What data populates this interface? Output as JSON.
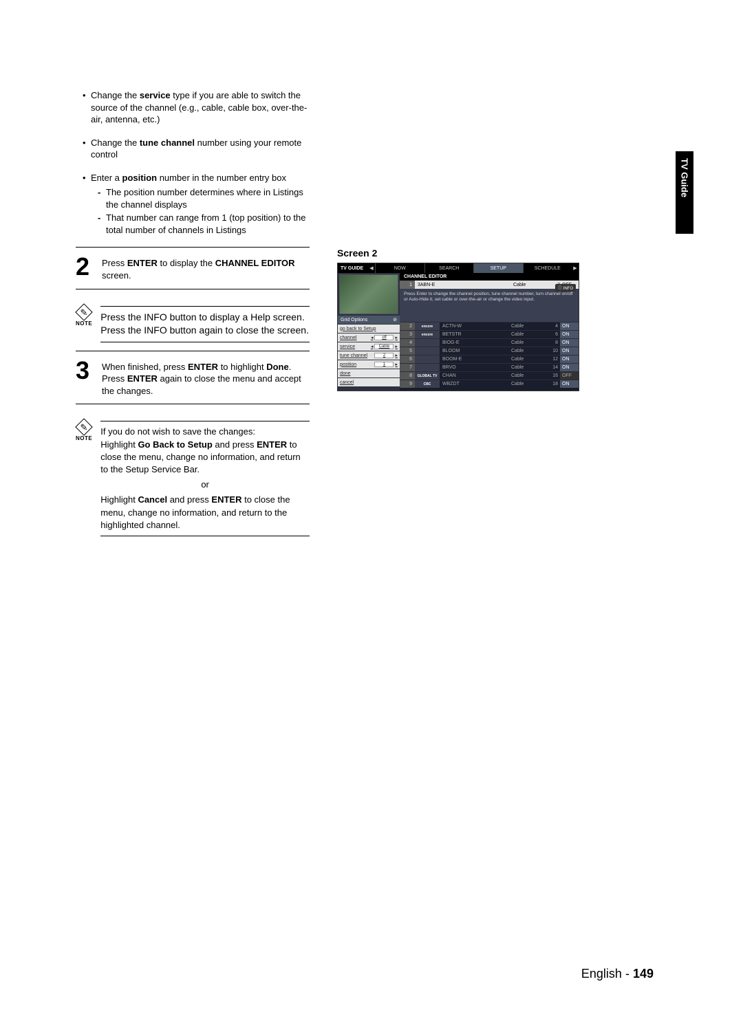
{
  "sideTab": "TV Guide",
  "bullets": [
    {
      "pre": "Change the ",
      "bold": "service",
      "post": " type if you are able to switch the source of the channel (e.g., cable, cable box, over-the-air, antenna, etc.)"
    },
    {
      "pre": "Change the ",
      "bold": "tune channel",
      "post": " number using your remote control"
    },
    {
      "pre": "Enter a ",
      "bold": "position",
      "post": " number in the number entry box",
      "sub": [
        "The position number determines where in Listings the channel displays",
        "That number can range from 1 (top position) to the total number of channels in Listings"
      ]
    }
  ],
  "step2": {
    "num": "2",
    "pre": "Press ",
    "b1": "ENTER",
    "mid": " to display the ",
    "b2": "CHANNEL EDITOR",
    "post": " screen."
  },
  "note1": {
    "label": "NOTE",
    "text": "Press the INFO button to display a Help screen. Press the INFO button again to close the screen."
  },
  "step3": {
    "num": "3",
    "line1_pre": "When finished, press ",
    "line1_b1": "ENTER",
    "line1_mid": " to highlight ",
    "line1_b2": "Done",
    "line1_post": ".",
    "line2_pre": "Press ",
    "line2_b1": "ENTER",
    "line2_post": " again to close the menu and accept the changes."
  },
  "note2": {
    "label": "NOTE",
    "intro": "If you do not wish to save the changes:",
    "p1_pre": "Highlight ",
    "p1_b1": "Go Back to Setup",
    "p1_mid": " and press ",
    "p1_b2": "ENTER",
    "p1_post": " to close the menu, change no information, and return to the Setup Service Bar.",
    "or": "or",
    "p2_pre": "Highlight ",
    "p2_b1": "Cancel",
    "p2_mid": " and press ",
    "p2_b2": "ENTER",
    "p2_post": " to close the menu, change no information, and return to the highlighted channel."
  },
  "screenLabel": "Screen 2",
  "tv": {
    "logo": "TV GUIDE",
    "tabs": [
      "NOW",
      "SEARCH",
      "SETUP",
      "SCHEDULE"
    ],
    "activeTab": 2,
    "editorHeader": "CHANNEL EDITOR",
    "infoBtn": "ⓘ INFO",
    "selected": {
      "num": "1",
      "name": "3ABN-E",
      "svc": "Cable",
      "n2": "2",
      "state": "OFF"
    },
    "hint": "Press Enter to change the channel position, tune channel number, turn channel on/off or Auto-Hide it, set cable or over-the-air or change the video input.",
    "gridHeader": "Grid Options",
    "gridRows": [
      {
        "label": "go back to Setup",
        "val": ""
      },
      {
        "label": "channel",
        "val": "off"
      },
      {
        "label": "service",
        "val": "Cable"
      },
      {
        "label": "tune channel",
        "val": "2"
      },
      {
        "label": "position",
        "val": "1"
      },
      {
        "label": "done",
        "val": ""
      },
      {
        "label": "cancel",
        "val": ""
      }
    ],
    "channels": [
      {
        "num": "2",
        "logo": "encore",
        "name": "ACTN-W",
        "svc": "Cable",
        "n2": "4",
        "state": "ON"
      },
      {
        "num": "3",
        "logo": "encore",
        "name": "BETSTR",
        "svc": "Cable",
        "n2": "6",
        "state": "ON"
      },
      {
        "num": "4",
        "logo": "",
        "name": "BIOG-E",
        "svc": "Cable",
        "n2": "8",
        "state": "ON"
      },
      {
        "num": "5",
        "logo": "",
        "name": "BLOOM",
        "svc": "Cable",
        "n2": "10",
        "state": "ON"
      },
      {
        "num": "6",
        "logo": "",
        "name": "BOOM-E",
        "svc": "Cable",
        "n2": "12",
        "state": "ON"
      },
      {
        "num": "7",
        "logo": "",
        "name": "BRVO",
        "svc": "Cable",
        "n2": "14",
        "state": "ON"
      },
      {
        "num": "8",
        "logo": "GLOBAL TV",
        "name": "CHAN",
        "svc": "Cable",
        "n2": "16",
        "state": "OFF"
      },
      {
        "num": "9",
        "logo": "CBC",
        "name": "WBZDT",
        "svc": "Cable",
        "n2": "18",
        "state": "ON"
      }
    ]
  },
  "footer": {
    "lang": "English - ",
    "page": "149"
  }
}
